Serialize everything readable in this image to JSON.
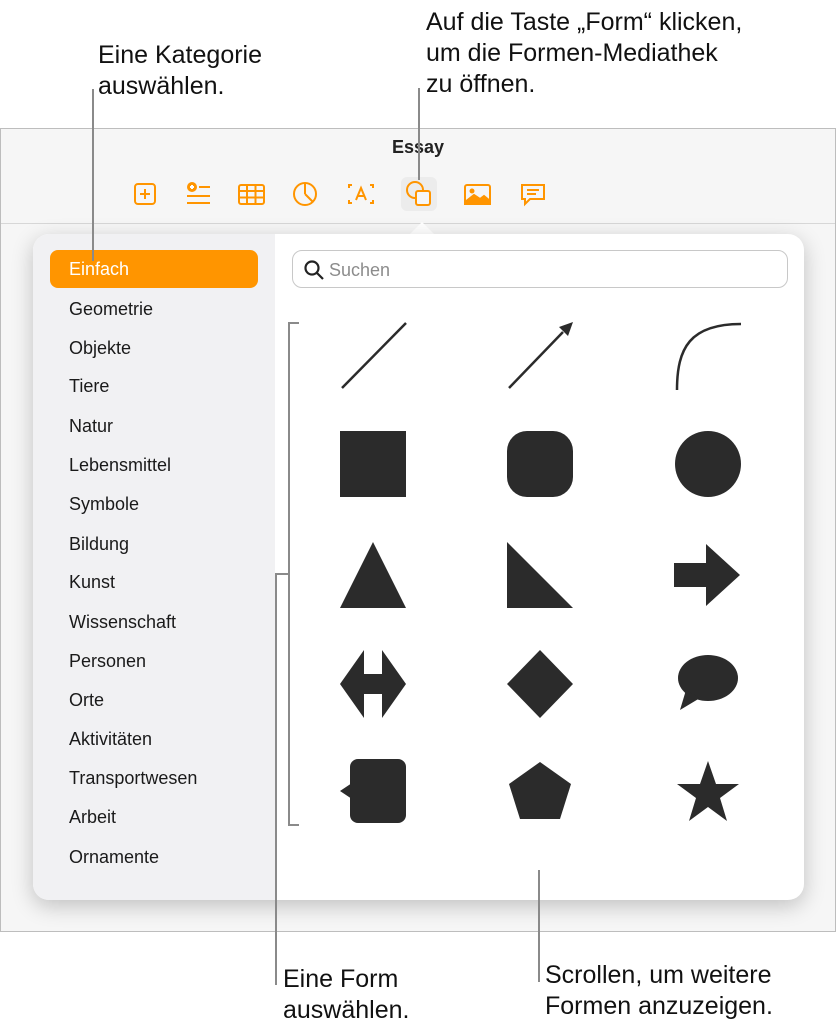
{
  "callouts": {
    "category": "Eine Kategorie\nauswählen.",
    "shape_button": "Auf die Taste „Form“ klicken,\num die Formen-Mediathek\nzu öffnen.",
    "choose_shape": "Eine Form\nauswählen.",
    "scroll": "Scrollen, um weitere\nFormen anzuzeigen."
  },
  "window": {
    "title": "Essay"
  },
  "toolbar": {
    "accent_color": "#ff9500",
    "buttons": [
      {
        "icon": "plus-square-icon"
      },
      {
        "icon": "add-list-icon"
      },
      {
        "icon": "table-icon"
      },
      {
        "icon": "pie-chart-icon"
      },
      {
        "icon": "text-box-icon"
      },
      {
        "icon": "shapes-icon",
        "active": true
      },
      {
        "icon": "photo-icon"
      },
      {
        "icon": "comment-icon"
      }
    ]
  },
  "shapes_library": {
    "search": {
      "placeholder": "Suchen",
      "value": ""
    },
    "categories": [
      {
        "label": "Einfach",
        "selected": true
      },
      {
        "label": "Geometrie"
      },
      {
        "label": "Objekte"
      },
      {
        "label": "Tiere"
      },
      {
        "label": "Natur"
      },
      {
        "label": "Lebensmittel"
      },
      {
        "label": "Symbole"
      },
      {
        "label": "Bildung"
      },
      {
        "label": "Kunst"
      },
      {
        "label": "Wissenschaft"
      },
      {
        "label": "Personen"
      },
      {
        "label": "Orte"
      },
      {
        "label": "Aktivitäten"
      },
      {
        "label": "Transportwesen"
      },
      {
        "label": "Arbeit"
      },
      {
        "label": "Ornamente"
      }
    ],
    "selected_color": "#ff9500",
    "shape_color": "#2b2b2b",
    "shapes": [
      "line-shape",
      "arrow-line-shape",
      "curve-shape",
      "square-shape",
      "rounded-square-shape",
      "circle-shape",
      "triangle-shape",
      "right-triangle-shape",
      "arrow-shape",
      "double-arrow-shape",
      "diamond-shape",
      "speech-bubble-shape",
      "callout-square-shape",
      "pentagon-shape",
      "star-shape"
    ]
  }
}
